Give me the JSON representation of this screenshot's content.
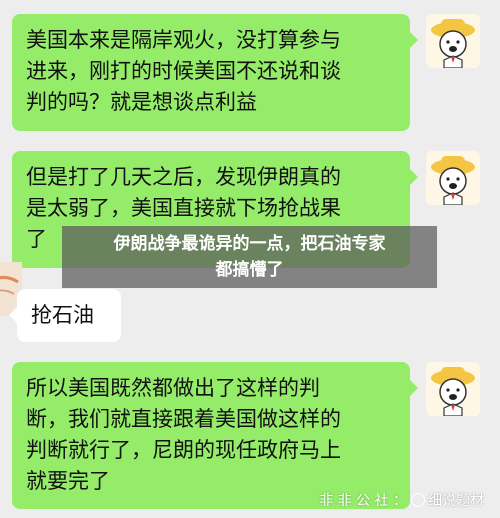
{
  "messages": [
    {
      "side": "right",
      "lines": [
        "美国本来是隔岸观火，没打算参与",
        "进来，刚打的时候美国不还说和谈",
        "判的吗？就是想谈点利益"
      ]
    },
    {
      "side": "right",
      "lines": [
        "但是打了几天之后，发现伊朗真的",
        "是太弱了，美国直接就下场抢战果",
        "了"
      ]
    },
    {
      "side": "left",
      "lines": [
        "抢石油"
      ]
    },
    {
      "side": "right",
      "lines": [
        "所以美国既然都做出了这样的判",
        "断，我们就直接跟着美国做这样的",
        "判断就行了，尼朗的现任政府马上",
        "就要完了"
      ]
    }
  ],
  "overlay": {
    "line1": "伊朗战争最诡异的一点，把石油专家",
    "line2": "都搞懵了"
  },
  "watermark": {
    "prefix": "非 非 公 社 ：",
    "brand": "细说题材"
  },
  "colors": {
    "background": "#ededed",
    "outgoing_bubble": "#95ec69",
    "incoming_bubble": "#ffffff"
  },
  "icons": {
    "self_avatar": "cartoon-cowboy-avatar-icon",
    "peer_avatar": "peer-avatar-icon"
  }
}
